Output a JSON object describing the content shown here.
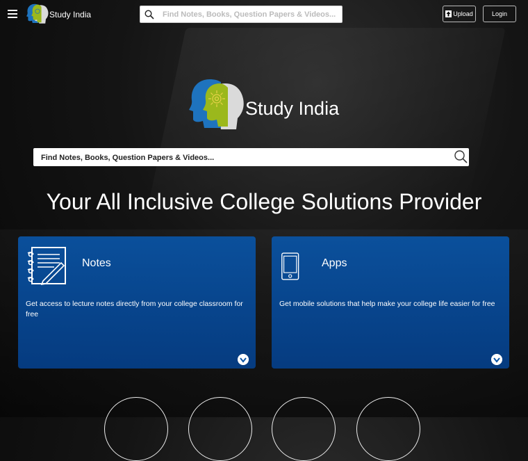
{
  "header": {
    "brand": "Study India",
    "search_placeholder": "Find Notes, Books, Question Papers & Videos...",
    "upload_label": "Upload",
    "login_label": "Login"
  },
  "hero": {
    "brand": "Study India",
    "search_placeholder": "Find Notes, Books, Question Papers & Videos...",
    "headline": "Your All Inclusive College Solutions Provider"
  },
  "cards": [
    {
      "title": "Notes",
      "description": "Get access to lecture notes directly from your college classroom for free",
      "icon": "notes-icon"
    },
    {
      "title": "Apps",
      "description": "Get mobile solutions that help make your college life easier for free",
      "icon": "tablet-icon"
    }
  ],
  "colors": {
    "card_blue": "#0954a6",
    "background": "#111111",
    "logo_blue": "#1e73be",
    "logo_green": "#9bb81c",
    "logo_gray": "#d9d9d9"
  }
}
